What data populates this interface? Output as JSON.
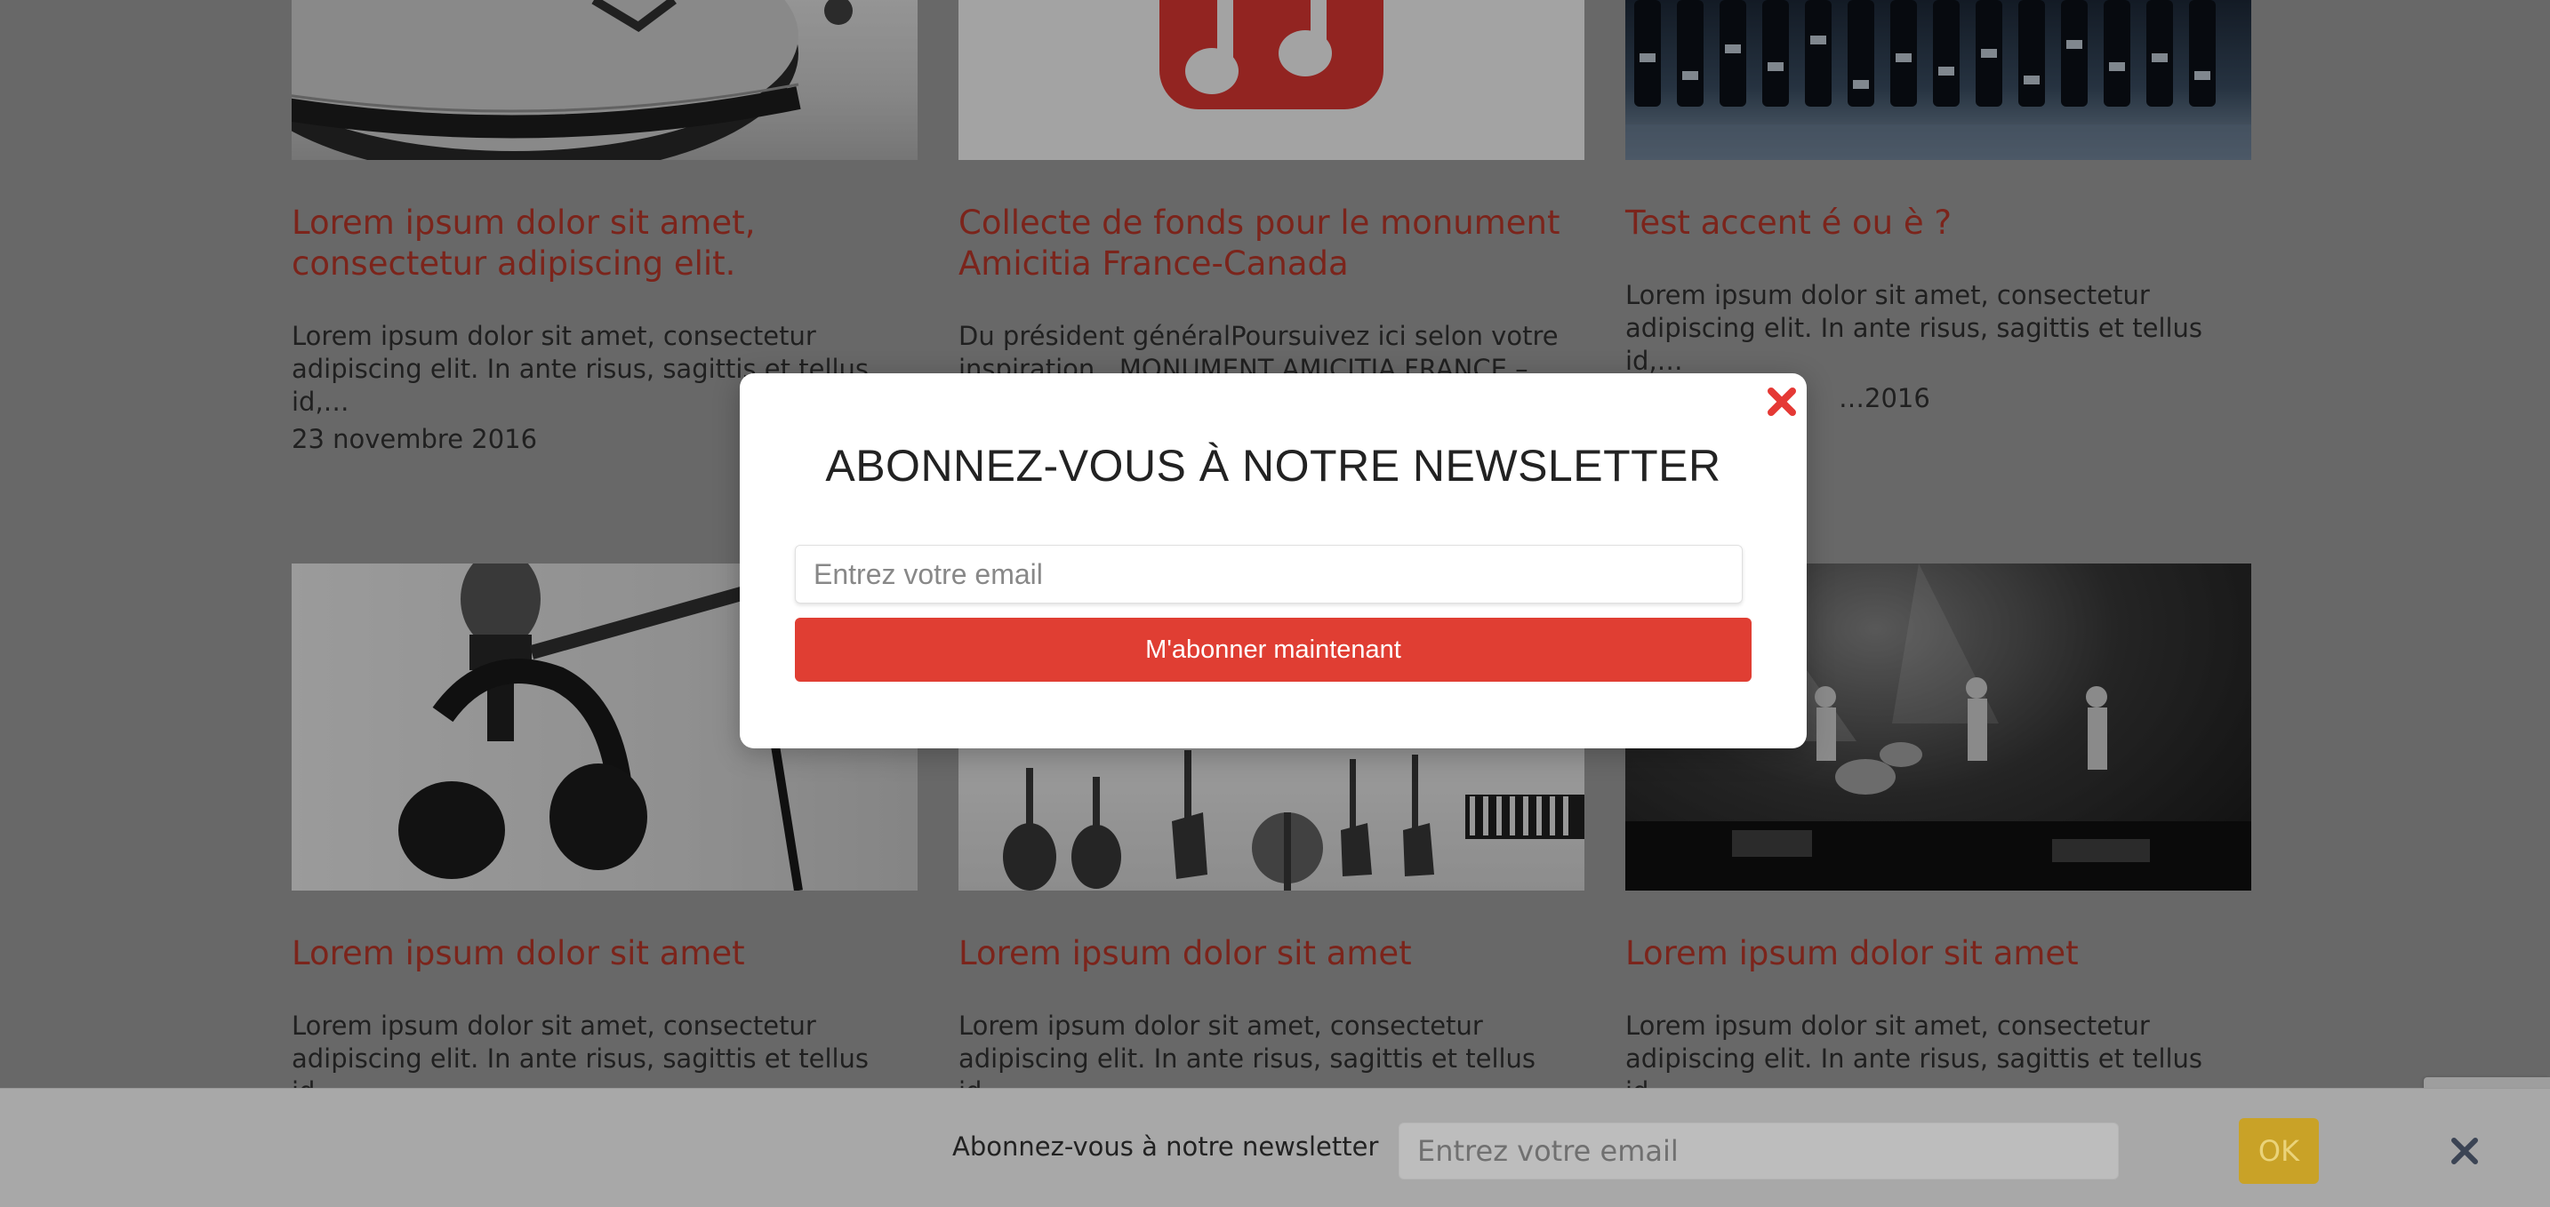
{
  "posts": [
    {
      "title": "Lorem ipsum dolor sit amet, consectetur adipiscing elit.",
      "excerpt": "Lorem ipsum dolor sit amet, consectetur adipiscing elit. In ante risus, sagittis et tellus id,…",
      "date": "23 novembre 2016"
    },
    {
      "title": "Collecte de fonds pour le monument Amicitia France-Canada",
      "excerpt": "Du président généralPoursuivez ici selon votre inspiration...MONUMENT AMICITIA FRANCE –",
      "date": ""
    },
    {
      "title": "Test accent é ou è ?",
      "excerpt": "Lorem ipsum dolor sit amet, consectetur adipiscing elit. In ante risus, sagittis et tellus id,…",
      "date": "…2016"
    },
    {
      "title": "Lorem ipsum dolor sit amet",
      "excerpt": "Lorem ipsum dolor sit amet, consectetur adipiscing elit. In ante risus, sagittis et tellus id,…"
    },
    {
      "title": "Lorem ipsum dolor sit amet",
      "excerpt": "Lorem ipsum dolor sit amet, consectetur adipiscing elit. In ante risus, sagittis et tellus id,…"
    },
    {
      "title": "Lorem ipsum dolor sit amet",
      "excerpt": "Lorem ipsum dolor sit amet, consectetur adipiscing elit. In ante risus, sagittis et tellus id,…"
    }
  ],
  "modal": {
    "title": "ABONNEZ-VOUS À NOTRE NEWSLETTER",
    "email_placeholder": "Entrez votre email",
    "submit_label": "M'abonner maintenant",
    "close_icon": "close-x-icon"
  },
  "bottom_bar": {
    "label": "Abonnez-vous à notre newsletter",
    "email_placeholder": "Entrez votre email",
    "ok_label": "OK",
    "close_icon": "close-x-icon"
  },
  "colors": {
    "accent_red": "#e03e33",
    "title_red": "#c0392b",
    "ok_yellow": "#c9a227"
  }
}
